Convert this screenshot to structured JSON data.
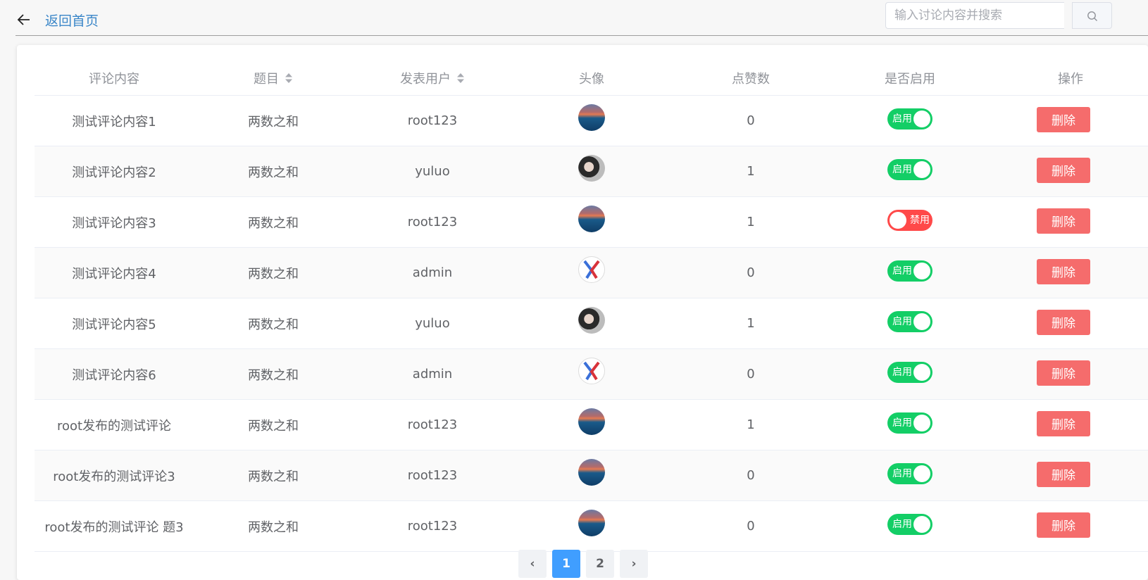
{
  "header": {
    "back_label": "返回首页",
    "search_placeholder": "输入讨论内容并搜索",
    "search_value": ""
  },
  "table": {
    "columns": [
      "评论内容",
      "题目",
      "发表用户",
      "头像",
      "点赞数",
      "是否启用",
      "操作"
    ],
    "sortable_columns": [
      "题目",
      "发表用户"
    ],
    "rows": [
      {
        "content": "测试评论内容1",
        "problem": "两数之和",
        "user": "root123",
        "avatar": "sea",
        "likes": "0",
        "enabled": true,
        "switch_label": "启用",
        "action": "删除"
      },
      {
        "content": "测试评论内容2",
        "problem": "两数之和",
        "user": "yuluo",
        "avatar": "person",
        "likes": "1",
        "enabled": true,
        "switch_label": "启用",
        "action": "删除"
      },
      {
        "content": "测试评论内容3",
        "problem": "两数之和",
        "user": "root123",
        "avatar": "sea",
        "likes": "1",
        "enabled": false,
        "switch_label": "禁用",
        "action": "删除"
      },
      {
        "content": "测试评论内容4",
        "problem": "两数之和",
        "user": "admin",
        "avatar": "logo",
        "likes": "0",
        "enabled": true,
        "switch_label": "启用",
        "action": "删除"
      },
      {
        "content": "测试评论内容5",
        "problem": "两数之和",
        "user": "yuluo",
        "avatar": "person",
        "likes": "1",
        "enabled": true,
        "switch_label": "启用",
        "action": "删除"
      },
      {
        "content": "测试评论内容6",
        "problem": "两数之和",
        "user": "admin",
        "avatar": "logo",
        "likes": "0",
        "enabled": true,
        "switch_label": "启用",
        "action": "删除"
      },
      {
        "content": "root发布的测试评论",
        "problem": "两数之和",
        "user": "root123",
        "avatar": "sea",
        "likes": "1",
        "enabled": true,
        "switch_label": "启用",
        "action": "删除"
      },
      {
        "content": "root发布的测试评论3",
        "problem": "两数之和",
        "user": "root123",
        "avatar": "sea",
        "likes": "0",
        "enabled": true,
        "switch_label": "启用",
        "action": "删除"
      },
      {
        "content": "root发布的测试评论 题3",
        "problem": "两数之和",
        "user": "root123",
        "avatar": "sea",
        "likes": "0",
        "enabled": true,
        "switch_label": "启用",
        "action": "删除"
      }
    ]
  },
  "pagination": {
    "prev": "‹",
    "next": "›",
    "pages": [
      "1",
      "2"
    ],
    "current": "1"
  },
  "colors": {
    "switch_on": "#13ce66",
    "switch_off": "#ff4949",
    "delete_button": "#f56c6c",
    "link": "#3a86c8",
    "active_page": "#409eff"
  }
}
